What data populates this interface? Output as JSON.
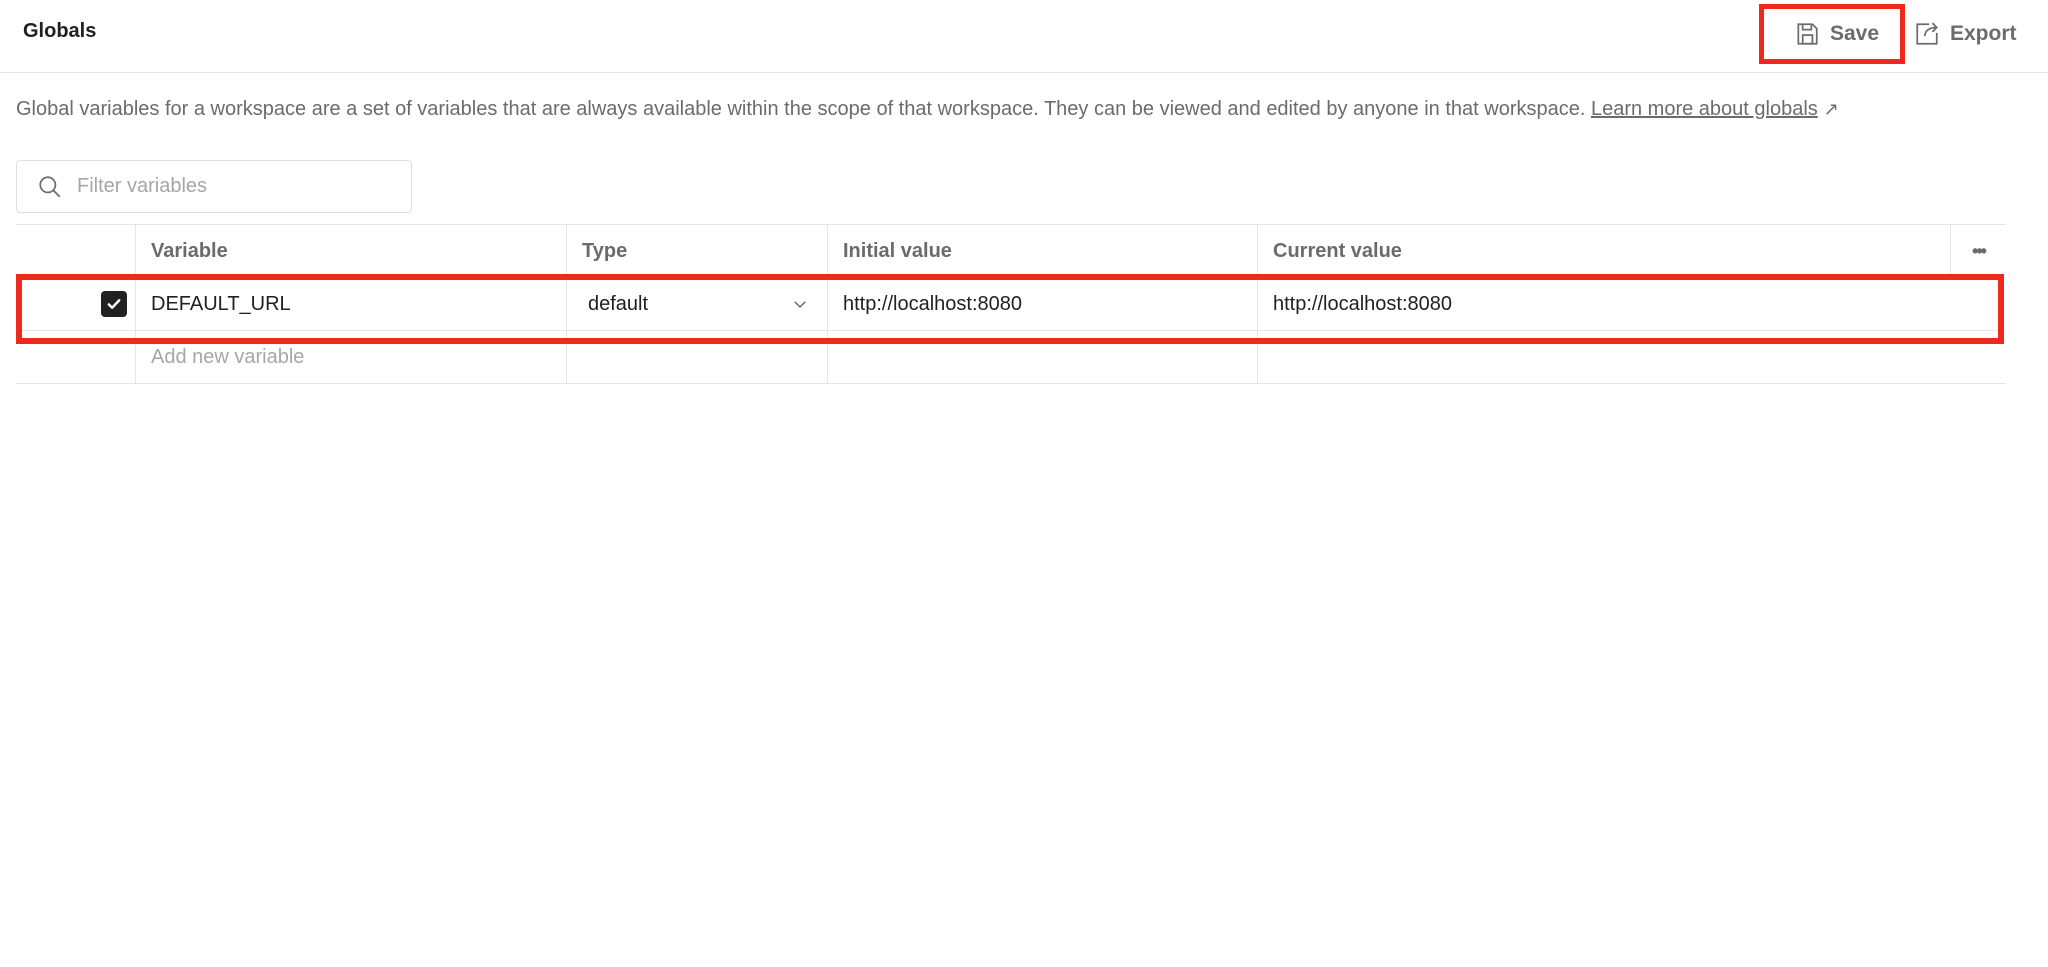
{
  "header": {
    "title": "Globals",
    "save_label": "Save",
    "export_label": "Export"
  },
  "description": {
    "text": "Global variables for a workspace are a set of variables that are always available within the scope of that workspace. They can be viewed and edited by anyone in that workspace.",
    "link_label": "Learn more about globals",
    "link_arrow": "↗"
  },
  "search": {
    "placeholder": "Filter variables"
  },
  "table": {
    "columns": [
      "Variable",
      "Type",
      "Initial value",
      "Current value"
    ],
    "more_icon": "•••",
    "rows": [
      {
        "enabled": true,
        "variable": "DEFAULT_URL",
        "type": "default",
        "initial_value": "http://localhost:8080",
        "current_value": "http://localhost:8080"
      }
    ],
    "add_placeholder": "Add new variable"
  },
  "colors": {
    "highlight": "#ee2a1d",
    "text": "#212121",
    "muted": "#6b6b6b",
    "border": "#e6e6e6"
  }
}
